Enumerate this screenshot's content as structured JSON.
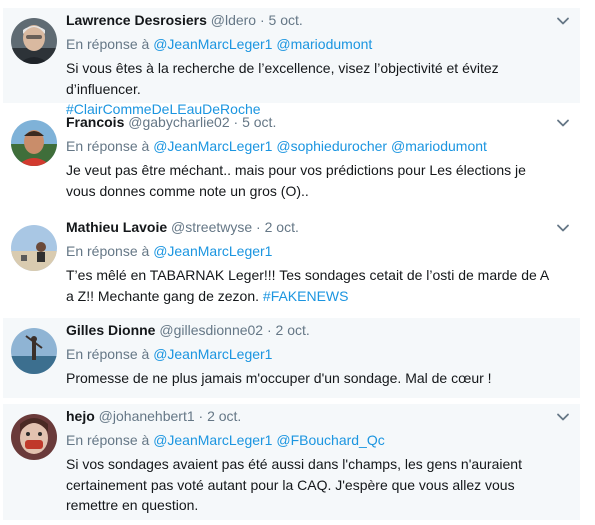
{
  "reply_prefix": "En réponse à",
  "tweets": [
    {
      "name": "Lawrence Desrosiers",
      "handle": "@ldero",
      "sep": "·",
      "time": "5 oct.",
      "mentions": [
        "@JeanMarcLeger1",
        "@mariodumont"
      ],
      "text": "Si vous êtes à la recherche de l’excellence, visez l’objectivité et évitez d’influencer.",
      "hashtag": "#ClairCommeDeLEauDeRoche"
    },
    {
      "name": "Francois",
      "handle": "@gabycharlie02",
      "sep": "·",
      "time": "5 oct.",
      "mentions": [
        "@JeanMarcLeger1",
        "@sophiedurocher",
        "@mariodumont"
      ],
      "text": "Je veut pas être méchant.. mais pour vos prédictions pour Les élections je vous donnes comme note un gros (O)..",
      "hashtag": ""
    },
    {
      "name": "Mathieu Lavoie",
      "handle": "@streetwyse",
      "sep": "·",
      "time": "2 oct.",
      "mentions": [
        "@JeanMarcLeger1"
      ],
      "text": "T’es mêlé en TABARNAK Leger!!! Tes sondages cetait de l’osti de marde de A a Z!! Mechante gang de zezon.",
      "hashtag": "#FAKENEWS"
    },
    {
      "name": "Gilles Dionne",
      "handle": "@gillesdionne02",
      "sep": "·",
      "time": "2 oct.",
      "mentions": [
        "@JeanMarcLeger1"
      ],
      "text": "Promesse de ne plus jamais m'occuper d'un sondage. Mal de cœur !",
      "hashtag": ""
    },
    {
      "name": "hejo",
      "handle": "@johanehbert1",
      "sep": "·",
      "time": "2 oct.",
      "mentions": [
        "@JeanMarcLeger1",
        "@FBouchard_Qc"
      ],
      "text": "Si vos sondages avaient pas été aussi dans l'champs, les gens n'auraient certainement pas voté autant pour la CAQ. J'espère que vous allez vous remettre en question.",
      "hashtag": ""
    }
  ],
  "colors": {
    "link": "#1b95e0",
    "muted": "#657786",
    "text": "#14171a",
    "shade": "#f5f8fa"
  },
  "icons": {
    "menu": "chevron-down-icon"
  }
}
